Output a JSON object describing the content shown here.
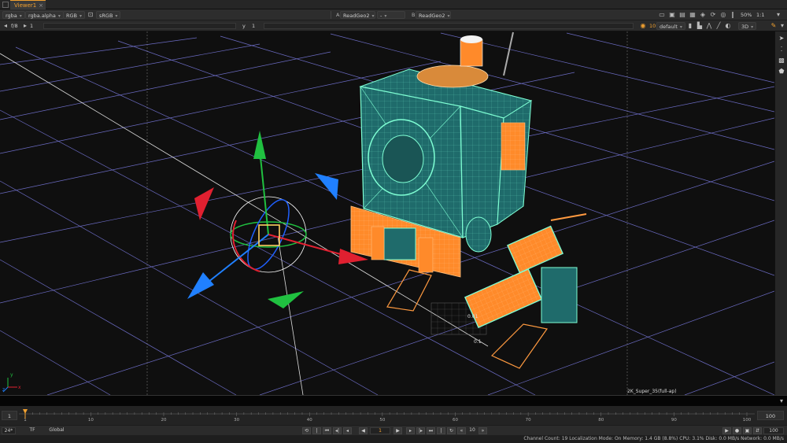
{
  "tab": {
    "title": "Viewer1",
    "close": "×"
  },
  "toolbar1": {
    "channels": "rgba",
    "alpha": "rgba.alpha",
    "colorspace1": "RGB",
    "colorspace2": "sRGB",
    "input_a_letter": "A",
    "input_a": "ReadGeo2",
    "composite": "-",
    "input_b_letter": "B",
    "input_b": "ReadGeo2",
    "zoom": "50%",
    "ratio": "1:1"
  },
  "toolbar2": {
    "fstop": "f/8",
    "gain": "1",
    "y_label": "y",
    "gamma": "1",
    "frame_num": "10",
    "camera": "default",
    "view_mode": "3D"
  },
  "viewport": {
    "label_uv1": "0.01",
    "label_uv2": "0.1",
    "format": "2K_Super_35(full-ap)",
    "axis_x": "x",
    "axis_y": "y",
    "axis_z": "z"
  },
  "timeline": {
    "start": "1",
    "end": "100",
    "ticks": [
      "1",
      "10",
      "20",
      "30",
      "40",
      "50",
      "60",
      "70",
      "80",
      "90",
      "100"
    ]
  },
  "transport": {
    "fps": "24*",
    "tf": "TF",
    "scope": "Global",
    "current_frame": "1",
    "step": "10",
    "end_frame": "100"
  },
  "status": {
    "text": "Channel Count: 19  Localization Mode: On  Memory: 1.4 GB (8.8%)  CPU: 3.1%  Disk: 0.0 MB/s  Network: 0.0 MB/s"
  },
  "colors": {
    "accent": "#f0a030",
    "teal": "#1f6b6b",
    "wire": "#7fffd4",
    "orange": "#ff8a2a",
    "grid": "#8080ff"
  }
}
